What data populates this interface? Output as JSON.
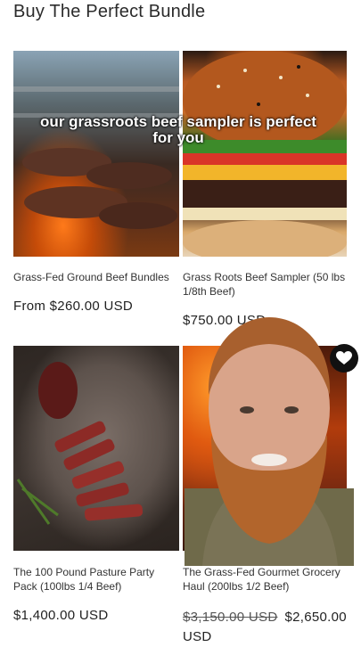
{
  "page": {
    "heading": "Buy The Perfect Bundle"
  },
  "overlay": {
    "caption": "our grassroots beef sampler is perfect for you"
  },
  "products": [
    {
      "title": "Grass-Fed Ground Beef Bundles",
      "price": "From $260.00 USD"
    },
    {
      "title": "Grass Roots Beef Sampler (50 lbs 1/8th Beef)",
      "price": "$750.00 USD"
    },
    {
      "title": "The 100 Pound Pasture Party Pack (100lbs 1/4 Beef)",
      "price": "$1,400.00 USD"
    },
    {
      "title": "The Grass-Fed Gourmet Grocery Haul (200lbs 1/2 Beef)",
      "compare_price": "$3,150.00 USD",
      "price": "$2,650.00 USD"
    }
  ],
  "icons": {
    "wishlist": "heart-icon"
  },
  "colors": {
    "text": "#222222",
    "heart_button": "#111111"
  }
}
